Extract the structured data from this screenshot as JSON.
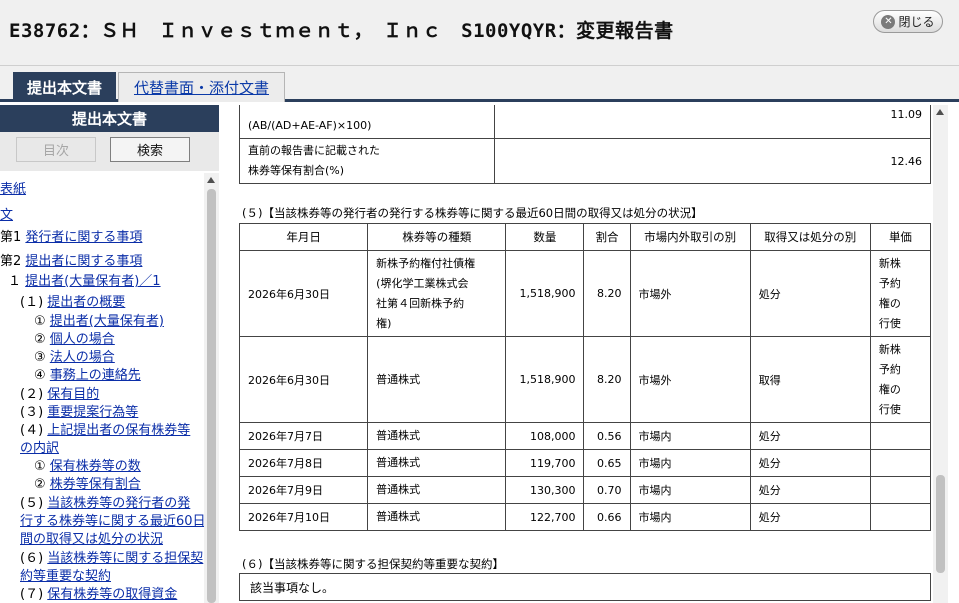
{
  "header": {
    "title": "E38762：ＳＨ　Ｉｎｖｅｓｔｍｅｎｔ，　Ｉｎｃ　S100YQYR：変更報告書",
    "close_label": "閉じる"
  },
  "tabs": [
    {
      "label": "提出本文書"
    },
    {
      "label": "代替書面・添付文書"
    }
  ],
  "sidebar": {
    "heading": "提出本文書",
    "next_label": "目次",
    "search_label": "検索",
    "toc": [
      {
        "prefix": "",
        "label": "表紙"
      },
      {
        "prefix": "",
        "label": "文"
      },
      {
        "prefix": "第1 ",
        "label": "発行者に関する事項"
      },
      {
        "prefix": "第2 ",
        "label": "提出者に関する事項"
      },
      {
        "prefix": "１ ",
        "label": "提出者(大量保有者)／1"
      },
      {
        "prefix": "(１) ",
        "label": "提出者の概要"
      },
      {
        "prefix": "① ",
        "label": "提出者(大量保有者)"
      },
      {
        "prefix": "② ",
        "label": "個人の場合"
      },
      {
        "prefix": "③ ",
        "label": "法人の場合"
      },
      {
        "prefix": "④ ",
        "label": "事務上の連絡先"
      },
      {
        "prefix": "(２) ",
        "label": "保有目的"
      },
      {
        "prefix": "(３) ",
        "label": "重要提案行為等"
      },
      {
        "prefix": "(４) ",
        "label": "上記提出者の保有株券等"
      },
      {
        "prefix": "",
        "label": "の内訳"
      },
      {
        "prefix": "① ",
        "label": "保有株券等の数"
      },
      {
        "prefix": "② ",
        "label": "株券等保有割合"
      },
      {
        "prefix": "(５) ",
        "label": "当該株券等の発行者の発"
      },
      {
        "prefix": "",
        "label": "行する株券等に関する最近60日"
      },
      {
        "prefix": "",
        "label": "間の取得又は処分の状況"
      },
      {
        "prefix": "(６) ",
        "label": "当該株券等に関する担保契"
      },
      {
        "prefix": "",
        "label": "約等重要な契約"
      },
      {
        "prefix": "(７) ",
        "label": "保有株券等の取得資金"
      }
    ]
  },
  "ratio_table": {
    "rows": [
      {
        "label_lines": [
          "(AB/(AD+AE-AF)×100)"
        ],
        "value": "11.09"
      },
      {
        "label_lines": [
          "直前の報告書に記載された",
          "株券等保有割合(%)"
        ],
        "value": "12.46"
      }
    ]
  },
  "section5": {
    "title": "(５)【当該株券等の発行者の発行する株券等に関する最近60日間の取得又は処分の状況】",
    "headers": [
      "年月日",
      "株券等の種類",
      "数量",
      "割合",
      "市場内外取引の別",
      "取得又は処分の別",
      "単価"
    ],
    "rows": [
      {
        "date": "2026年6月30日",
        "type_lines": [
          "新株予約権付社債権",
          "(堺化学工業株式会",
          "社第４回新株予約",
          "権)"
        ],
        "qty": "1,518,900",
        "ratio": "8.20",
        "market": "市場外",
        "action": "処分",
        "price_lines": [
          "新株",
          "予約",
          "権の",
          "行使"
        ]
      },
      {
        "date": "2026年6月30日",
        "type_lines": [
          "普通株式"
        ],
        "qty": "1,518,900",
        "ratio": "8.20",
        "market": "市場外",
        "action": "取得",
        "price_lines": [
          "新株",
          "予約",
          "権の",
          "行使"
        ]
      },
      {
        "date": "2026年7月7日",
        "type_lines": [
          "普通株式"
        ],
        "qty": "108,000",
        "ratio": "0.56",
        "market": "市場内",
        "action": "処分",
        "price_lines": []
      },
      {
        "date": "2026年7月8日",
        "type_lines": [
          "普通株式"
        ],
        "qty": "119,700",
        "ratio": "0.65",
        "market": "市場内",
        "action": "処分",
        "price_lines": []
      },
      {
        "date": "2026年7月9日",
        "type_lines": [
          "普通株式"
        ],
        "qty": "130,300",
        "ratio": "0.70",
        "market": "市場内",
        "action": "処分",
        "price_lines": []
      },
      {
        "date": "2026年7月10日",
        "type_lines": [
          "普通株式"
        ],
        "qty": "122,700",
        "ratio": "0.66",
        "market": "市場内",
        "action": "処分",
        "price_lines": []
      }
    ]
  },
  "section6": {
    "title": "(６)【当該株券等に関する担保契約等重要な契約】",
    "body": "該当事項なし。"
  }
}
